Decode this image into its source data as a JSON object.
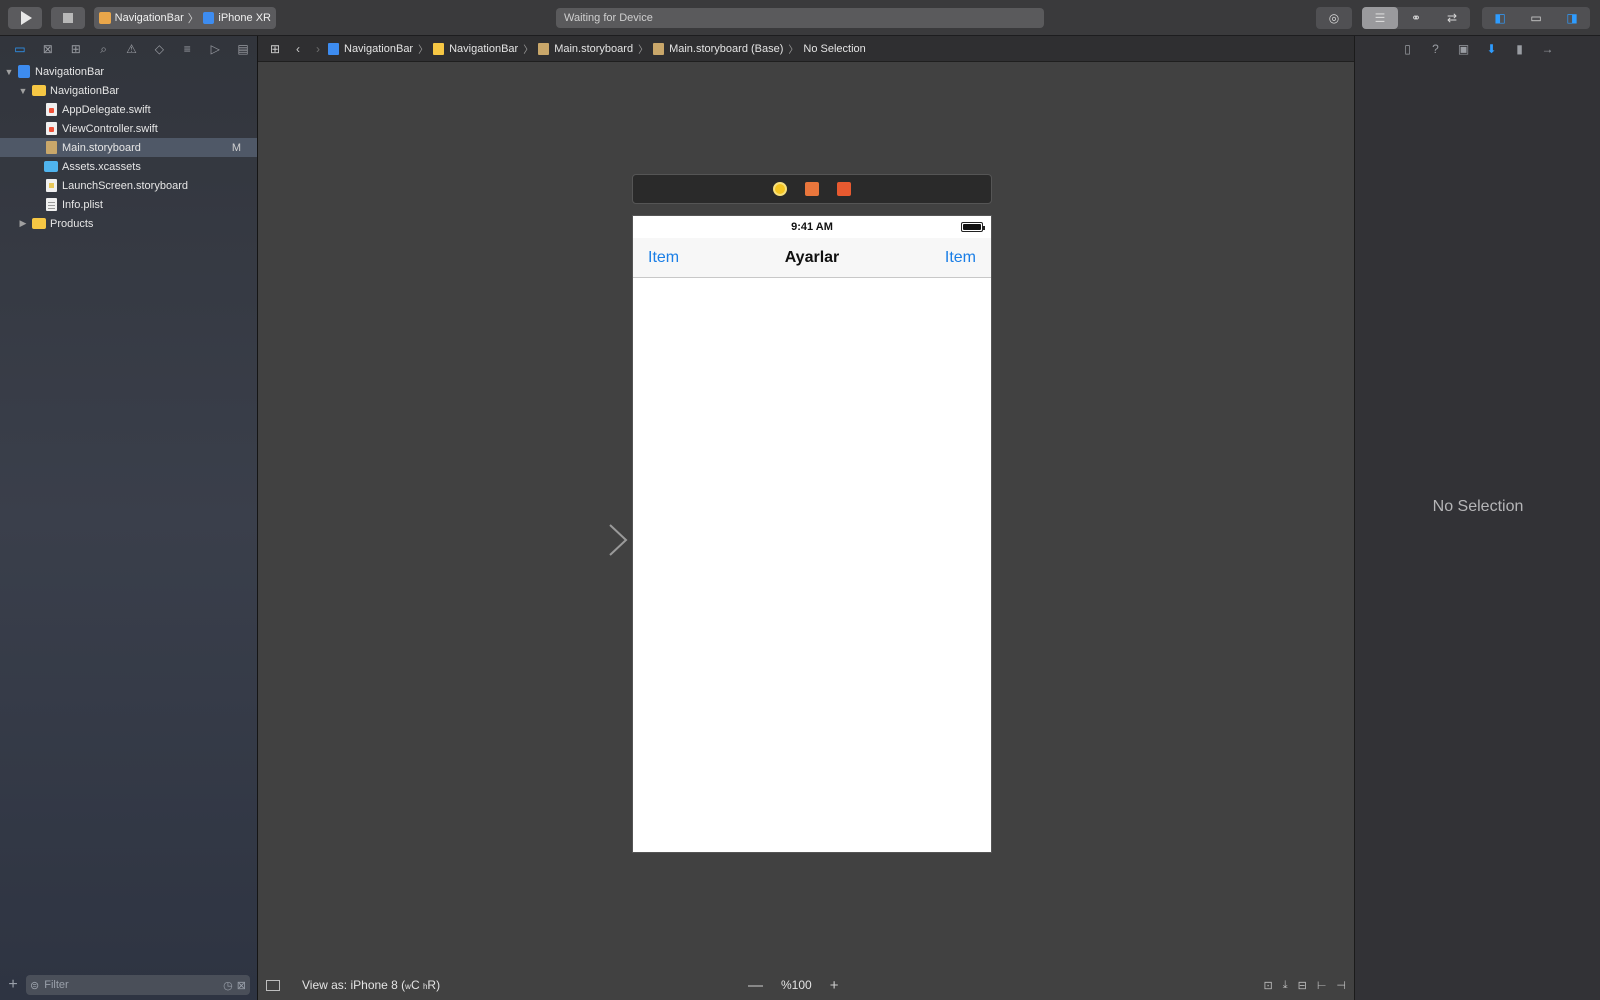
{
  "toolbar": {
    "scheme": "NavigationBar",
    "destination": "iPhone XR",
    "activity_status": "Waiting for Device",
    "icons": [
      "run-icon",
      "stop-icon",
      "breakpoint-icon",
      "standard-editor-icon",
      "assistant-editor-icon",
      "version-editor-icon",
      "navigator-toggle-icon",
      "debug-area-toggle-icon",
      "utilities-toggle-icon"
    ]
  },
  "navigator": {
    "tab_icons": [
      "folder-icon",
      "source-control-icon",
      "hierarchy-icon",
      "search-icon",
      "warning-icon",
      "test-icon",
      "debug-icon",
      "breakpoint-icon",
      "report-icon"
    ],
    "items": [
      {
        "label": "NavigationBar",
        "kind": "project",
        "depth": 0,
        "expanded": true
      },
      {
        "label": "NavigationBar",
        "kind": "folder",
        "depth": 1,
        "expanded": true
      },
      {
        "label": "AppDelegate.swift",
        "kind": "swift",
        "depth": 2
      },
      {
        "label": "ViewController.swift",
        "kind": "swift",
        "depth": 2
      },
      {
        "label": "Main.storyboard",
        "kind": "storyboard",
        "depth": 2,
        "selected": true,
        "badge": "M"
      },
      {
        "label": "Assets.xcassets",
        "kind": "assets",
        "depth": 2
      },
      {
        "label": "LaunchScreen.storyboard",
        "kind": "storyboard2",
        "depth": 2
      },
      {
        "label": "Info.plist",
        "kind": "plist",
        "depth": 2
      },
      {
        "label": "Products",
        "kind": "folder",
        "depth": 1,
        "expanded": false
      }
    ],
    "filter_placeholder": "Filter"
  },
  "jumpbar": {
    "crumbs": [
      "NavigationBar",
      "NavigationBar",
      "Main.storyboard",
      "Main.storyboard (Base)",
      "No Selection"
    ]
  },
  "canvas": {
    "status_time": "9:41 AM",
    "nav_left": "Item",
    "nav_title": "Ayarlar",
    "nav_right": "Item"
  },
  "editor_bottom": {
    "view_as": "View as: iPhone 8 (",
    "size_class_w": "w",
    "size_class_w_value": "C",
    "size_class_h": "h",
    "size_class_h_value": "R)",
    "zoom_minus": "—",
    "zoom_level": "%100",
    "zoom_plus": "+"
  },
  "inspector": {
    "tab_icons": [
      "file-inspector-icon",
      "help-icon",
      "identity-icon",
      "attributes-icon",
      "size-icon",
      "connections-icon"
    ],
    "empty_text": "No Selection"
  },
  "colors": {
    "accent": "#2e9cff",
    "ios_tint": "#1a7ee6",
    "selected_row": "#4f5867"
  }
}
